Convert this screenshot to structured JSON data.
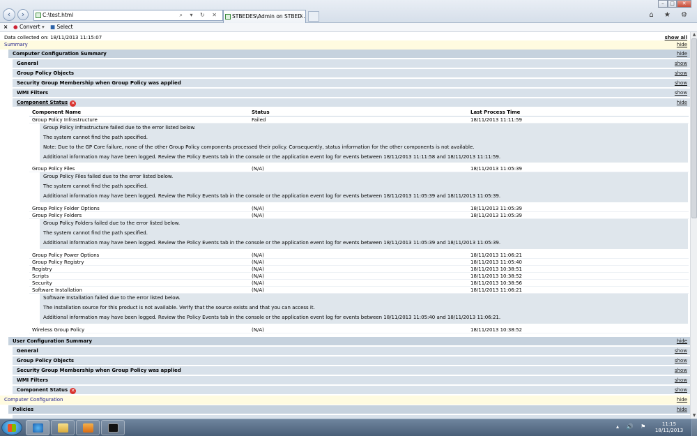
{
  "browser": {
    "address": "C:\\test.html",
    "address_controls": "⌕ ▾ ↻ ✕",
    "tab_title": "STBEDES\\Admin on STBED...",
    "tools": "⌂ ★ ⚙",
    "window_buttons": {
      "min": "–",
      "max": "□",
      "close": "✕"
    }
  },
  "command_bar": {
    "close_x": "×",
    "convert_label": "Convert",
    "select_label": "Select"
  },
  "report": {
    "data_collected": "Data collected on: 18/11/2013 11:15:07",
    "show_all": "show all",
    "summary": {
      "label": "Summary",
      "link": "hide"
    },
    "computer_summary": {
      "label": "Computer Configuration Summary",
      "link": "hide",
      "sections": [
        {
          "label": "General",
          "link": "show"
        },
        {
          "label": "Group Policy Objects",
          "link": "show"
        },
        {
          "label": "Security Group Membership when Group Policy was applied",
          "link": "show"
        },
        {
          "label": "WMI Filters",
          "link": "show"
        }
      ],
      "component_status": {
        "label": "Component Status",
        "link": "hide"
      },
      "table": {
        "headers": [
          "Component Name",
          "Status",
          "Last Process Time"
        ],
        "rows": [
          {
            "name": "Group Policy Infrastructure",
            "status": "Failed",
            "time": "18/11/2013 11:11:59",
            "errors": [
              "Group Policy Infrastructure failed due to the error listed below.",
              "The system cannot find the path specified.",
              "Note: Due to the GP Core failure, none of the other Group Policy components processed their policy. Consequently, status information for the other components is not available.",
              "Additional information may have been logged. Review the Policy Events tab in the console or the application event log for events between 18/11/2013 11:11:58 and 18/11/2013 11:11:59."
            ]
          },
          {
            "name": "Group Policy Files",
            "status": "(N/A)",
            "time": "18/11/2013 11:05:39",
            "errors": [
              "Group Policy Files failed due to the error listed below.",
              "The system cannot find the path specified.",
              "Additional information may have been logged. Review the Policy Events tab in the console or the application event log for events between 18/11/2013 11:05:39 and 18/11/2013 11:05:39."
            ]
          },
          {
            "name": "Group Policy Folder Options",
            "status": "(N/A)",
            "time": "18/11/2013 11:05:39",
            "errors": []
          },
          {
            "name": "Group Policy Folders",
            "status": "(N/A)",
            "time": "18/11/2013 11:05:39",
            "errors": [
              "Group Policy Folders failed due to the error listed below.",
              "The system cannot find the path specified.",
              "Additional information may have been logged. Review the Policy Events tab in the console or the application event log for events between 18/11/2013 11:05:39 and 18/11/2013 11:05:39."
            ]
          },
          {
            "name": "Group Policy Power Options",
            "status": "(N/A)",
            "time": "18/11/2013 11:06:21",
            "errors": []
          },
          {
            "name": "Group Policy Registry",
            "status": "(N/A)",
            "time": "18/11/2013 11:05:40",
            "errors": []
          },
          {
            "name": "Registry",
            "status": "(N/A)",
            "time": "18/11/2013 10:38:51",
            "errors": []
          },
          {
            "name": "Scripts",
            "status": "(N/A)",
            "time": "18/11/2013 10:38:52",
            "errors": []
          },
          {
            "name": "Security",
            "status": "(N/A)",
            "time": "18/11/2013 10:38:56",
            "errors": []
          },
          {
            "name": "Software Installation",
            "status": "(N/A)",
            "time": "18/11/2013 11:06:21",
            "errors": [
              "Software Installation failed due to the error listed below.",
              "The installation source for this product is not available. Verify that the source exists and that you can access it.",
              "Additional information may have been logged. Review the Policy Events tab in the console or the application event log for events between 18/11/2013 11:05:40 and 18/11/2013 11:06:21."
            ]
          },
          {
            "name": "Wireless Group Policy",
            "status": "(N/A)",
            "time": "18/11/2013 10:38:52",
            "errors": []
          }
        ]
      }
    },
    "user_summary": {
      "label": "User Configuration Summary",
      "link": "hide",
      "sections": [
        {
          "label": "General",
          "link": "show"
        },
        {
          "label": "Group Policy Objects",
          "link": "show"
        },
        {
          "label": "Security Group Membership when Group Policy was applied",
          "link": "show"
        },
        {
          "label": "WMI Filters",
          "link": "show"
        },
        {
          "label": "Component Status",
          "link": "show"
        }
      ]
    },
    "computer_config": {
      "label": "Computer Configuration",
      "link": "hide"
    },
    "policies": {
      "label": "Policies",
      "link": "hide"
    }
  },
  "taskbar": {
    "apps": [
      "internet-explorer",
      "explorer",
      "media-player",
      "command-prompt"
    ],
    "tray_icons": "▴ 🔊 ⚑",
    "time": "11:15",
    "date": "18/11/2013"
  },
  "colors": {
    "summary_bg": "#fffbe0",
    "header_bg": "#c6d2de",
    "subheader_bg": "#d8e1ea",
    "error_block_bg": "#dfe6ec",
    "error_icon": "#d9302b"
  }
}
